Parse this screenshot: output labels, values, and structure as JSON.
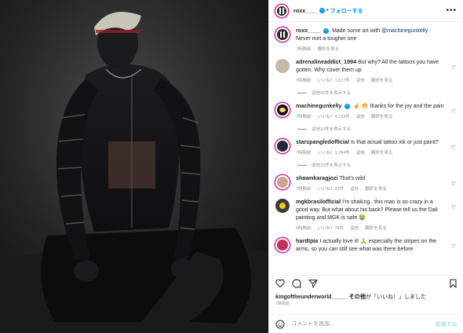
{
  "post": {
    "username": "roxx____",
    "verified_mark": "✓",
    "separator": "•",
    "follow_label": "フォローする",
    "more_label": "•••",
    "caption_user": "roxx____",
    "caption_text": "Made some art with ",
    "caption_mention": "@machinegunkelly",
    "caption_line2": "Never met a tougher one",
    "caption_time": "7時間前",
    "translate_label": "翻訳を見る"
  },
  "comments": [
    {
      "user": "adrenalineaddict_1994",
      "text": "But why? All the tattoos you have gotten. Why cover them up",
      "time": "7時間前",
      "likes": "いいね！1,077件",
      "reply": "返信",
      "translate": "翻訳を見る",
      "replies": "返信42件を表示する"
    },
    {
      "user": "machinegunkelly",
      "verified": true,
      "text": "☝️ 😁 thanks for the joy and the pain",
      "time": "7時間前",
      "likes": "いいね！4,103件",
      "reply": "返信",
      "translate": "翻訳を見る",
      "replies": "返信10件を表示する"
    },
    {
      "user": "starspangledofficial",
      "text": "Is that actual tattoo ink or just paint?",
      "time": "7時間前",
      "likes": "いいね！1,294件",
      "reply": "返信",
      "translate": "翻訳を見る",
      "replies": "返信15件を表示する"
    },
    {
      "user": "shawnkaragjozi",
      "text": "That's wild",
      "time": "7時間前",
      "likes": "いいね！37件",
      "reply": "返信",
      "translate": "翻訳を見る"
    },
    {
      "user": "mgkbrasilofficial",
      "text": "I'm shaking.. this man is so crazy in a good way. But what about his back? Please tell us the Dali painting and MGK is safe 😭",
      "time": "6時間前",
      "likes": "いいね！75件",
      "reply": "返信",
      "translate": "翻訳を見る"
    },
    {
      "user": "hardtpia",
      "text": "I actually love it! 🙏 especially the stripes on the arms, so you can still see what was there before",
      "time": "",
      "likes": "",
      "reply": "",
      "translate": ""
    }
  ],
  "footer": {
    "liked_by_user": "kingoftheunderworld_____",
    "liked_by_text": " その他",
    "liked_suffix": "が「いいね！」しました",
    "date": "7時間前",
    "comment_placeholder": "コメントを追加...",
    "post_label": "投稿する"
  },
  "icons": {
    "heart": "heart-icon",
    "comment": "comment-icon",
    "share": "share-icon",
    "bookmark": "bookmark-icon",
    "emoji": "emoji-icon"
  },
  "colors": {
    "accent": "#0095f6",
    "link": "#00376b",
    "muted": "#8e8e8e",
    "ring": "#d6249f"
  }
}
